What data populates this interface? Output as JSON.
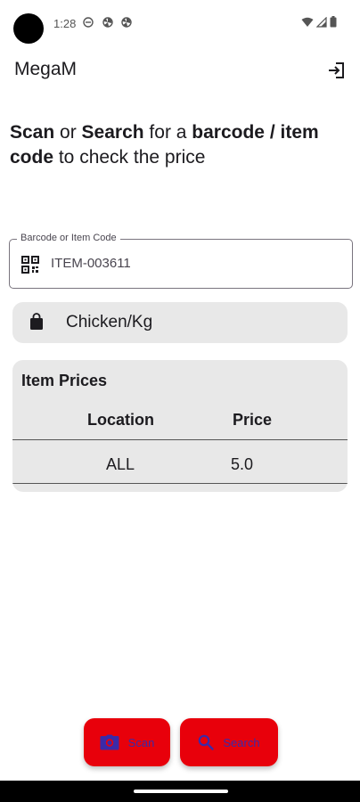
{
  "status_bar": {
    "time": "1:28",
    "icons": [
      "do-not-disturb-icon",
      "pinwheel-icon",
      "pinwheel-icon",
      "wifi-icon",
      "signal-icon",
      "battery-icon"
    ]
  },
  "app_bar": {
    "title": "MegaM",
    "logout_icon": "logout-icon"
  },
  "instruction": {
    "part1": "Scan",
    "part2": " or ",
    "part3": "Search",
    "part4": " for a ",
    "part5": "barcode / item code",
    "part6": " to check the price"
  },
  "search_field": {
    "label": "Barcode or Item Code",
    "value": "ITEM-003611",
    "icon": "qr-code-icon"
  },
  "product": {
    "name": "Chicken/Kg",
    "icon": "shopping-bag-icon"
  },
  "prices": {
    "title": "Item Prices",
    "columns": [
      "Location",
      "Price"
    ],
    "rows": [
      {
        "location": "ALL",
        "price": "5.0"
      }
    ]
  },
  "actions": {
    "scan_label": "Scan",
    "search_label": "Search",
    "button_color": "#e8000b",
    "label_color": "#3b2aa8"
  }
}
